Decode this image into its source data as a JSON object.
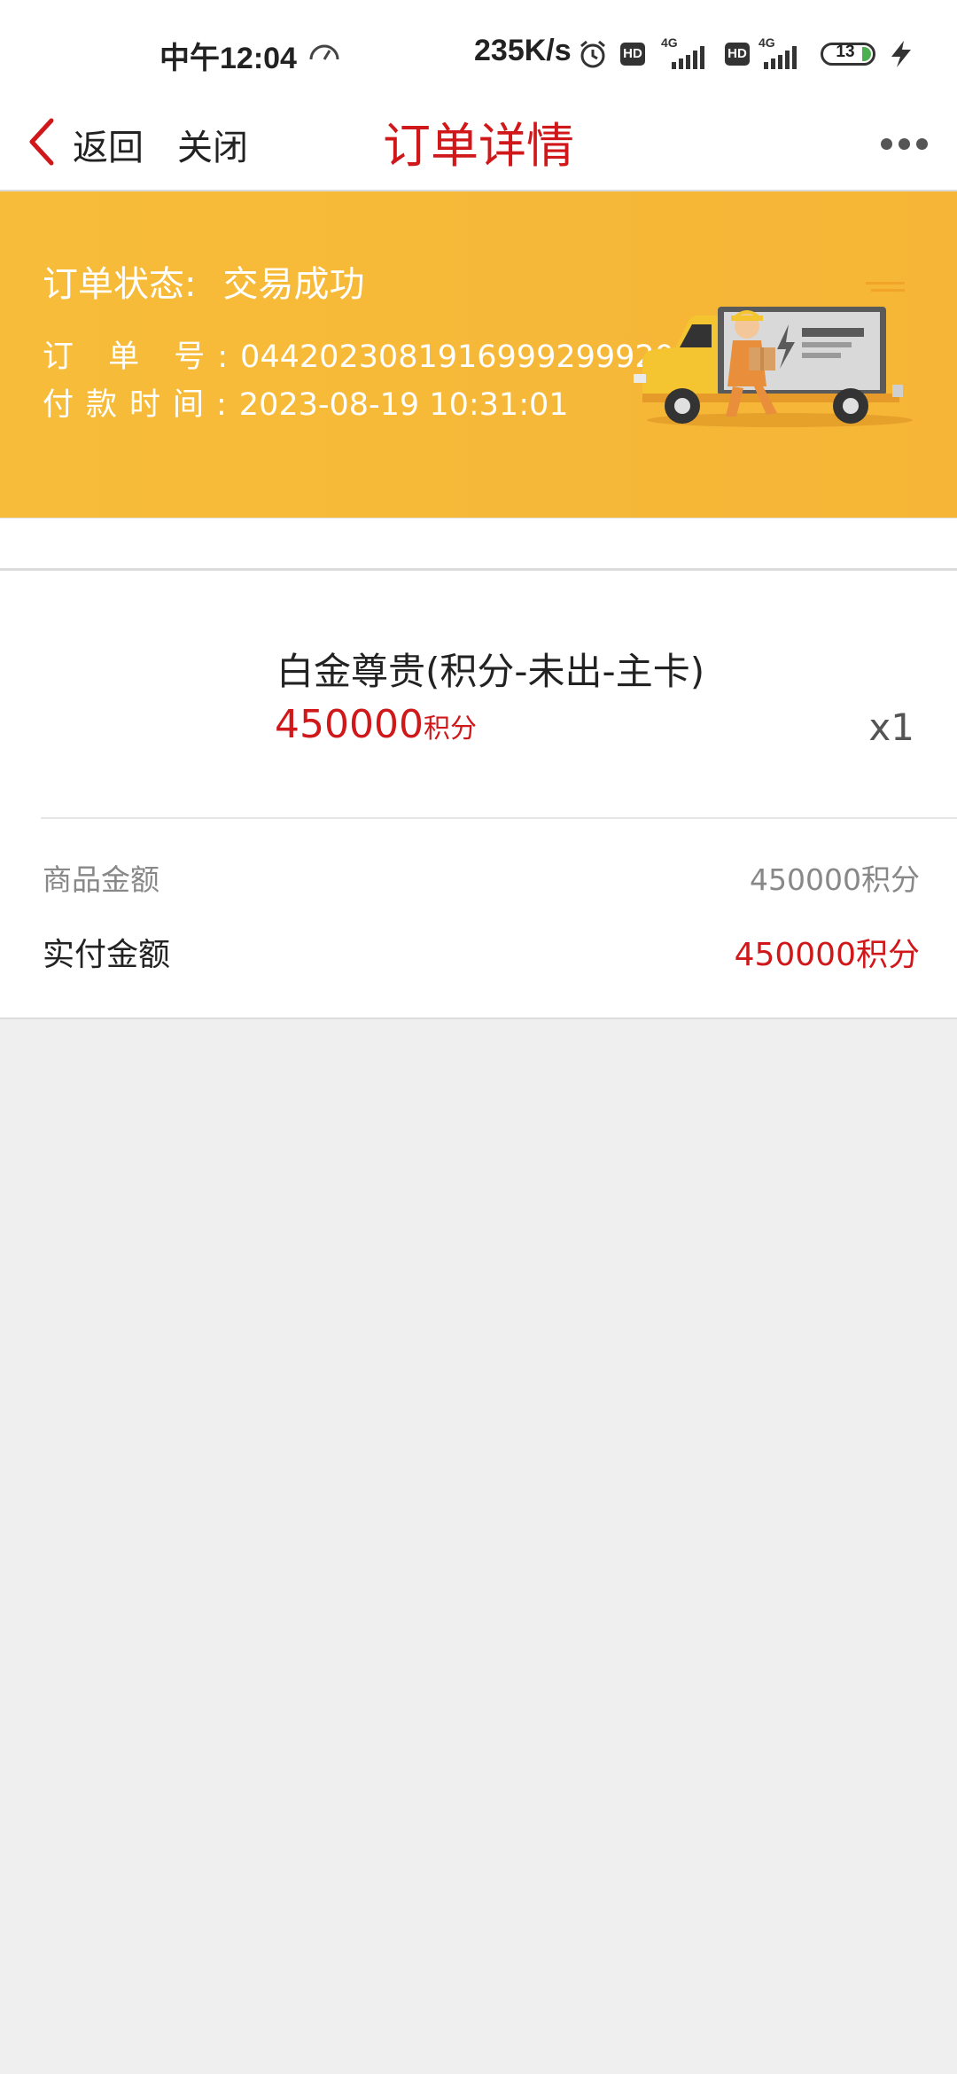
{
  "status_bar": {
    "time": "中午12:04",
    "net_speed": "235K/s",
    "hd_label": "HD",
    "network_label": "4G",
    "battery_level": "13"
  },
  "nav": {
    "back_label": "返回",
    "close_label": "关闭",
    "title": "订单详情"
  },
  "order": {
    "status_label": "订单状态:",
    "status_value": "交易成功",
    "number_label": "订 单 号:",
    "number_value": "044202308191699929992000",
    "pay_time_label": "付款时间:",
    "pay_time_value": "2023-08-19 10:31:01"
  },
  "product": {
    "name": "白金尊贵(积分-未出-主卡)",
    "price": "450000",
    "price_unit": "积分",
    "quantity": "x1"
  },
  "summary": {
    "subtotal_label": "商品金额",
    "subtotal_value": "450000积分",
    "paid_label": "实付金额",
    "paid_value": "450000积分"
  },
  "colors": {
    "accent_red": "#d0181b",
    "banner_yellow": "#f7bc3a"
  }
}
